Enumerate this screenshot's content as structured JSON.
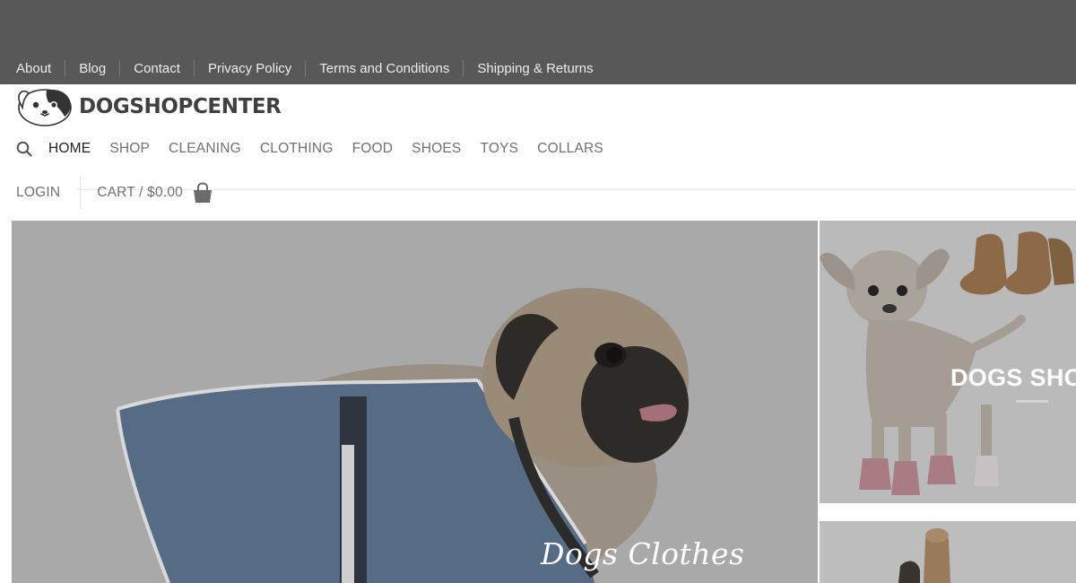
{
  "top_links": [
    "About",
    "Blog",
    "Contact",
    "Privacy Policy",
    "Terms and Conditions",
    "Shipping & Returns"
  ],
  "brand": "DOGSHOPCENTER",
  "main_nav": {
    "items": [
      "HOME",
      "SHOP",
      "CLEANING",
      "CLOTHING",
      "FOOD",
      "SHOES",
      "TOYS",
      "COLLARS"
    ],
    "active": "HOME"
  },
  "account": {
    "login": "LOGIN",
    "cart": "CART / $0.00"
  },
  "hero": {
    "caption": "Dogs Clothes"
  },
  "side_banner": {
    "title": "DOGS SHO"
  },
  "colors": {
    "topbar": "#585858",
    "overlay": "#a9a9a9",
    "nav_text": "#707070"
  },
  "icons": [
    "search-icon",
    "shopping-bag-icon",
    "dog-logo-icon"
  ]
}
